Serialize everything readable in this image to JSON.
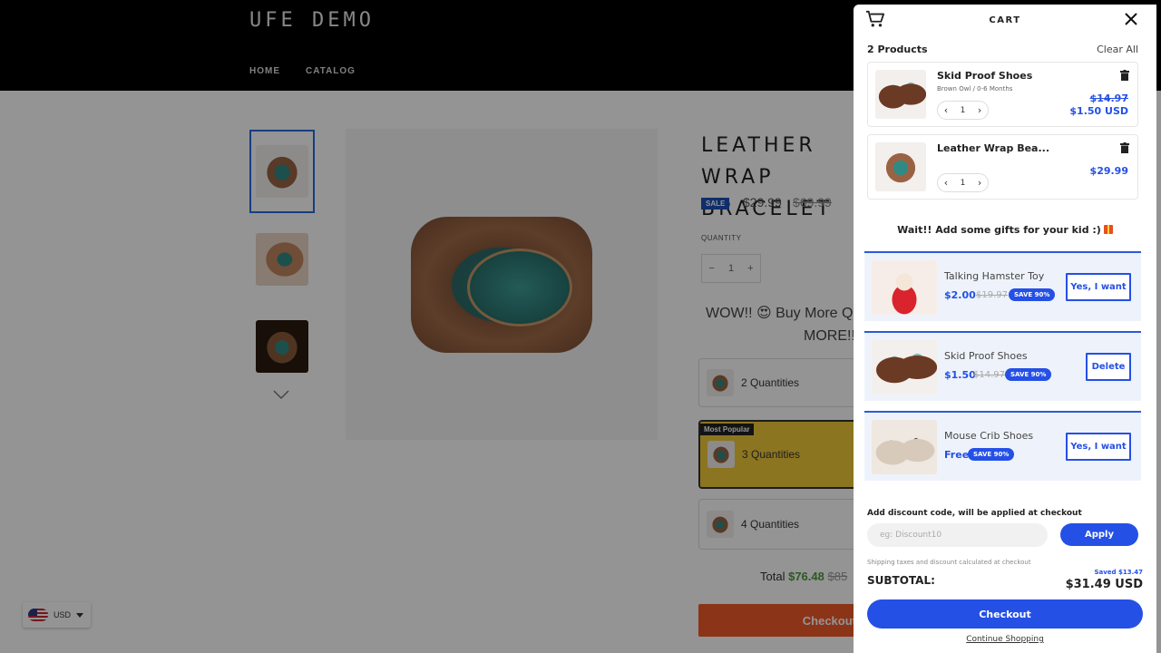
{
  "store": {
    "logo": "UFE DEMO",
    "nav": [
      "HOME",
      "CATALOG"
    ],
    "product": {
      "title_line1": "LEATHER WRAP",
      "title_line2": "BRACELET",
      "sale_badge": "SALE",
      "price": "$29.99",
      "compare_price": "$69.99",
      "quantity_label": "QUANTITY",
      "quantity_minus": "−",
      "quantity": "1",
      "quantity_plus": "+",
      "promo_line1": "WOW!! 😍 Buy More Q",
      "promo_line2": "MORE!!",
      "options": [
        "2 Quantities",
        "3 Quantities",
        "4 Quantities"
      ],
      "most_popular": "Most Popular",
      "total_label": "Total",
      "total_value": "$76.48",
      "total_was": "$85",
      "checkout": "Checkout"
    },
    "currency": "USD"
  },
  "cart": {
    "title": "CART",
    "count": "2 Products",
    "clear_all": "Clear All",
    "items": [
      {
        "name": "Skid Proof Shoes",
        "variant": "Brown Owl / 0-6 Months",
        "qty": "1",
        "was": "$14.97",
        "price": "$1.50 USD"
      },
      {
        "name": "Leather Wrap Bea...",
        "qty": "1",
        "price": "$29.99"
      }
    ],
    "upsell_title": "Wait!! Add some gifts for your kid :)",
    "upsells": [
      {
        "name": "Talking Hamster Toy",
        "price": "$2.00",
        "was": "$19.97",
        "save": "SAVE 90%",
        "button": "Yes, I want"
      },
      {
        "name": "Skid Proof Shoes",
        "price": "$1.50",
        "was": "$14.97",
        "save": "SAVE 90%",
        "button": "Delete"
      },
      {
        "name": "Mouse Crib Shoes",
        "price": "Free",
        "save": "SAVE 90%",
        "button": "Yes, I want"
      }
    ],
    "discount_label": "Add discount code, will be applied at checkout",
    "discount_placeholder": "eg: Discount10",
    "apply": "Apply",
    "shipping_note": "Shipping taxes and discount calculated at checkout",
    "saved": "Saved $13.47",
    "subtotal_label": "SUBTOTAL:",
    "subtotal_value": "$31.49 USD",
    "checkout": "Checkout",
    "continue": "Continue Shopping"
  },
  "colors": {
    "accent": "#2450e6",
    "header": "#000000",
    "sale": "#1d50b8",
    "checkout_store": "#ef5a2a",
    "popular": "#f2ca3a"
  }
}
